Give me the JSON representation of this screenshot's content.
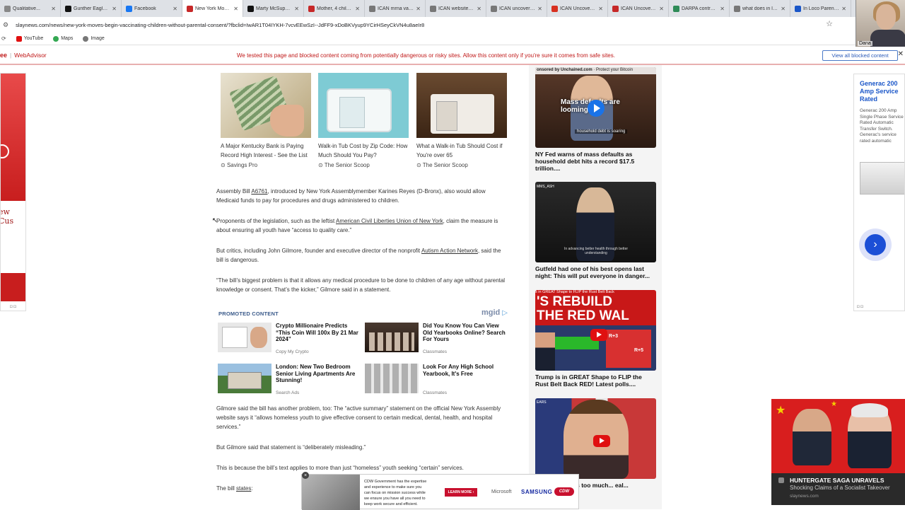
{
  "tabs": [
    {
      "title": "Qualitative...",
      "color": "#888888",
      "active": false
    },
    {
      "title": "Gunther Eagleman",
      "color": "#111111",
      "active": false
    },
    {
      "title": "Facebook",
      "color": "#1877f2",
      "active": false
    },
    {
      "title": "New York Moves...",
      "color": "#c62828",
      "active": true
    },
    {
      "title": "Marty McSupaffy",
      "color": "#111111",
      "active": false
    },
    {
      "title": "Mother, 4 childr...",
      "color": "#c62828",
      "active": false
    },
    {
      "title": "ICAN mrna vacci...",
      "color": "#777777",
      "active": false
    },
    {
      "title": "ICAN website - S...",
      "color": "#777777",
      "active": false
    },
    {
      "title": "ICAN uncovers a...",
      "color": "#777777",
      "active": false
    },
    {
      "title": "ICAN Uncovers a...",
      "color": "#d83020",
      "active": false
    },
    {
      "title": "ICAN Uncovers...",
      "color": "#c62828",
      "active": false
    },
    {
      "title": "DARPA controlli...",
      "color": "#2e8b57",
      "active": false
    },
    {
      "title": "what does in loc...",
      "color": "#777777",
      "active": false
    },
    {
      "title": "In Loco Parentis...",
      "color": "#1a56c8",
      "active": false
    }
  ],
  "url": "slaynews.com/news/new-york-moves-begin-vaccinating-children-without-parental-consent/?fbclid=IwAR1T04IYKH-7vcvEEwSzI--JdFF9-xDoBKVyup9YCirHSeyCkVN4u8aeIr8",
  "bookmarks": [
    {
      "label": "YouTube",
      "color": "#e01010"
    },
    {
      "label": "Maps",
      "color": "#34a853"
    },
    {
      "label": "Image",
      "color": "#777777"
    }
  ],
  "webcam_label": "Dana",
  "webadvisor": {
    "brand": "ee",
    "name": "WebAdvisor",
    "message": "We tested this page and blocked content coming from potentially dangerous or risky sites. Allow this content only if you're sure it comes from safe sites.",
    "view_all": "View all blocked content"
  },
  "left_ad": {
    "text": "ew Cus"
  },
  "right_ad": {
    "title": "Generac 200 Amp Service Rated",
    "desc": "Generac 200 Amp Single Phase Service Rated Automatic Transfer Switch. Generac's service rated automatic"
  },
  "top_cards": [
    {
      "title": "A Major Kentucky Bank is Paying Record High Interest - See the List",
      "source": "Savings Pro"
    },
    {
      "title": "Walk-in Tub Cost by Zip Code: How Much Should You Pay?",
      "source": "The Senior Scoop"
    },
    {
      "title": "What a Walk-in Tub Should Cost if You're over 65",
      "source": "The Senior Scoop"
    }
  ],
  "article": {
    "p1_pre": "Assembly Bill ",
    "p1_link": "A6761",
    "p1_post": ", introduced by New York Assemblymember Karines Reyes (D-Bronx), also would allow Medicaid funds to pay for procedures and drugs administered to children.",
    "p2_pre": "Proponents of the legislation, such as the leftist ",
    "p2_link": "American Civil Liberties Union of New York",
    "p2_post": ", claim the measure is about ensuring all youth have “access to quality care.”",
    "p3_pre": "But critics, including John Gilmore, founder and executive director of the nonprofit ",
    "p3_link": "Autism Action Network",
    "p3_post": ", said the bill is dangerous.",
    "p4": "“The bill’s biggest problem is that it allows any medical procedure to be done to children of any age without parental knowledge or consent. That’s the kicker,” Gilmore said in a statement.",
    "p5": "Gilmore said the bill has another problem, too: The “active summary” statement on the official New York Assembly website says it “allows homeless youth to give effective consent to certain medical, dental, health, and hospital services.”",
    "p6": "But Gilmore said that statement is “deliberately misleading.”",
    "p7": "This is because the bill’s text applies to more than just “homeless” youth seeking “certain” services.",
    "p8_pre": "The bill ",
    "p8_link": "states",
    "p8_post": ":"
  },
  "promoted": {
    "header": "PROMOTED CONTENT",
    "brand": "mgid",
    "items": [
      {
        "title": "Crypto Millionaire Predicts “This Coin Will 100x By 21 Mar 2024”",
        "source": "Copy My Crypto"
      },
      {
        "title": "Did You Know You Can View Old Yearbooks Online? Search For Yours",
        "source": "Classmates"
      },
      {
        "title": "London: New Two Bedroom Senior Living Apartments Are Stunning!",
        "source": "Search Ads"
      },
      {
        "title": "Look For Any High School Yearbook, It's Free",
        "source": "Classmates"
      }
    ]
  },
  "sidebar": {
    "sponsor_label": "onsored by Unchained.com",
    "sponsor_tag": "Protect your Bitcoin",
    "video1_overlay": "Mass defaults are looming",
    "video1_sub": "household debt is soaring",
    "video2_badge": "MMS_ASH",
    "video2_sub": "In advancing better health through better understanding",
    "video3_top": "s in GREAT Shape to FLIP the Rust Belt Back",
    "video3_big1": "'S REBUILD",
    "video3_big2": "THE RED WAL",
    "video3_r1": "R+3",
    "video3_r2": "R+5",
    "video4_top": "EARS",
    "items": [
      {
        "caption": "NY Fed warns of mass defaults as household debt hits a record $17.5 trillion...."
      },
      {
        "caption": "Gutfeld had one of his best opens last night: This will put everyone in danger..."
      },
      {
        "caption": "Trump is in GREAT Shape to FLIP the Rust Belt Back RED! Latest polls...."
      },
      {
        "caption": "o State Haley is too much... eal..."
      }
    ]
  },
  "bottom_ad": {
    "text": "CDW Government has the expertise and experience to make sure you can focus on mission success while we ensure you have all you need to keep work secure and efficient.",
    "learn": "LEARN MORE ›",
    "microsoft": "Microsoft",
    "samsung": "SAMSUNG",
    "cdw": "CDW"
  },
  "news_popup": {
    "headline": "HUNTERGATE SAGA UNRAVELS",
    "subtitle": "Shocking Claims of a Socialist Takeover",
    "domain": "slaynews.com"
  }
}
